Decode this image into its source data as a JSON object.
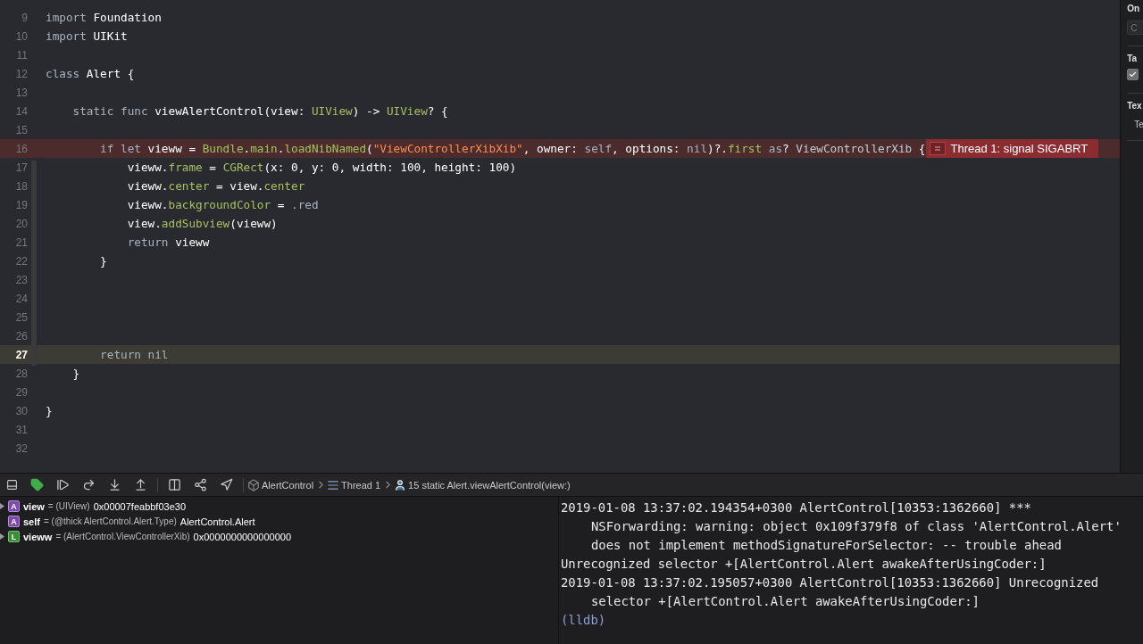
{
  "editor": {
    "lines": [
      {
        "number": "9",
        "current": false,
        "tokens": [
          {
            "kind": "kw",
            "t": "import"
          },
          {
            "kind": "plain",
            "t": " Foundation"
          }
        ]
      },
      {
        "number": "10",
        "current": false,
        "tokens": [
          {
            "kind": "kw",
            "t": "import"
          },
          {
            "kind": "plain",
            "t": " UIKit"
          }
        ]
      },
      {
        "number": "11",
        "current": false
      },
      {
        "number": "12",
        "current": false,
        "tokens": [
          {
            "kind": "kw",
            "t": "class"
          },
          {
            "kind": "plain",
            "t": " Alert {"
          }
        ]
      },
      {
        "number": "13",
        "current": false
      },
      {
        "number": "14",
        "current": false,
        "tokens": [
          {
            "kind": "kw",
            "t": "    static func"
          },
          {
            "kind": "plain",
            "t": " viewAlertControl(view: "
          },
          {
            "kind": "api",
            "t": "UIView"
          },
          {
            "kind": "plain",
            "t": ") -> "
          },
          {
            "kind": "api",
            "t": "UIView"
          },
          {
            "kind": "plain",
            "t": "? {"
          }
        ]
      },
      {
        "number": "15",
        "current": false
      },
      {
        "number": "16",
        "current": false,
        "error": "Thread 1: signal SIGABRT",
        "tokens": [
          {
            "kind": "kw",
            "t": "        if let"
          },
          {
            "kind": "plain",
            "t": " vieww = "
          },
          {
            "kind": "api",
            "t": "Bundle"
          },
          {
            "kind": "plain",
            "t": "."
          },
          {
            "kind": "api",
            "t": "main"
          },
          {
            "kind": "plain",
            "t": "."
          },
          {
            "kind": "api",
            "t": "loadNibNamed"
          },
          {
            "kind": "plain",
            "t": "("
          },
          {
            "kind": "str",
            "t": "\"ViewControllerXibXib\""
          },
          {
            "kind": "plain",
            "t": ", owner: "
          },
          {
            "kind": "kw",
            "t": "self"
          },
          {
            "kind": "plain",
            "t": ", options: "
          },
          {
            "kind": "kw",
            "t": "nil"
          },
          {
            "kind": "plain",
            "t": ")?."
          },
          {
            "kind": "api",
            "t": "first"
          },
          {
            "kind": "kw",
            "t": " as"
          },
          {
            "kind": "plain",
            "t": "? "
          },
          {
            "kind": "type",
            "t": "ViewControllerXib"
          },
          {
            "kind": "plain",
            "t": " {"
          }
        ]
      },
      {
        "number": "17",
        "current": false,
        "tokens": [
          {
            "kind": "plain",
            "t": "            vieww."
          },
          {
            "kind": "api",
            "t": "frame"
          },
          {
            "kind": "plain",
            "t": " = "
          },
          {
            "kind": "api",
            "t": "CGRect"
          },
          {
            "kind": "plain",
            "t": "(x: 0, y: 0, width: 100, height: 100)"
          }
        ]
      },
      {
        "number": "18",
        "current": false,
        "tokens": [
          {
            "kind": "plain",
            "t": "            vieww."
          },
          {
            "kind": "api",
            "t": "center"
          },
          {
            "kind": "plain",
            "t": " = view."
          },
          {
            "kind": "api",
            "t": "center"
          }
        ]
      },
      {
        "number": "19",
        "current": false,
        "tokens": [
          {
            "kind": "plain",
            "t": "            vieww."
          },
          {
            "kind": "api",
            "t": "backgroundColor"
          },
          {
            "kind": "plain",
            "t": " = "
          },
          {
            "kind": "kw",
            "t": ".red"
          }
        ]
      },
      {
        "number": "20",
        "current": false,
        "tokens": [
          {
            "kind": "plain",
            "t": "            view."
          },
          {
            "kind": "api",
            "t": "addSubview"
          },
          {
            "kind": "plain",
            "t": "(vieww)"
          }
        ]
      },
      {
        "number": "21",
        "current": false,
        "tokens": [
          {
            "kind": "kw",
            "t": "            return"
          },
          {
            "kind": "plain",
            "t": " vieww"
          }
        ]
      },
      {
        "number": "22",
        "current": false,
        "tokens": [
          {
            "kind": "plain",
            "t": "        }"
          }
        ]
      },
      {
        "number": "23",
        "current": false
      },
      {
        "number": "24",
        "current": false
      },
      {
        "number": "25",
        "current": false
      },
      {
        "number": "26",
        "current": false
      },
      {
        "number": "27",
        "current": true,
        "tokens": [
          {
            "kind": "kw",
            "t": "        return nil"
          }
        ]
      },
      {
        "number": "28",
        "current": false,
        "tokens": [
          {
            "kind": "plain",
            "t": "    }"
          }
        ]
      },
      {
        "number": "29",
        "current": false
      },
      {
        "number": "30",
        "current": false,
        "tokens": [
          {
            "kind": "plain",
            "t": "}"
          }
        ]
      },
      {
        "number": "31",
        "current": false
      },
      {
        "number": "32",
        "current": false
      }
    ]
  },
  "inspector": {
    "sections": [
      {
        "title": "On",
        "field": {
          "placeholder": "C"
        }
      },
      {
        "title": "Ta",
        "checkbox": {
          "checked": true
        }
      },
      {
        "title": "Tex",
        "label": "Te"
      }
    ]
  },
  "debug_bar": {
    "breakpoints_active": true,
    "breadcrumbs": [
      {
        "kind": "app",
        "label": "AlertControl"
      },
      {
        "kind": "thread",
        "label": "Thread 1"
      },
      {
        "kind": "frame",
        "label": "15 static Alert.viewAlertControl(view:)"
      }
    ]
  },
  "variables": [
    {
      "kind": "argument",
      "badge": "A",
      "expandable": true,
      "name": "view",
      "type": "= (UIView)",
      "value": "0x00007feabbf03e30"
    },
    {
      "kind": "argument",
      "badge": "A",
      "expandable": false,
      "name": "self",
      "type": "= (@thick AlertControl.Alert.Type)",
      "value": "AlertControl.Alert"
    },
    {
      "kind": "local",
      "badge": "L",
      "expandable": true,
      "name": "vieww",
      "type": "= (AlertControl.ViewControllerXib)",
      "value": "0x0000000000000000"
    }
  ],
  "console": [
    {
      "kind": "entry",
      "text": "2019-01-08 13:37:02.194354+0300 AlertControl[10353:1362660] ***"
    },
    {
      "kind": "continuation",
      "text": "NSForwarding: warning: object 0x109f379f8 of class 'AlertControl.Alert'"
    },
    {
      "kind": "continuation",
      "text": "does not implement methodSignatureForSelector: -- trouble ahead"
    },
    {
      "kind": "entry",
      "text": "Unrecognized selector +[AlertControl.Alert awakeAfterUsingCoder:]"
    },
    {
      "kind": "entry",
      "text": "2019-01-08 13:37:02.195057+0300 AlertControl[10353:1362660] Unrecognized"
    },
    {
      "kind": "continuation",
      "text": "selector +[AlertControl.Alert awakeAfterUsingCoder:]"
    },
    {
      "kind": "prompt",
      "text": "(lldb)"
    }
  ]
}
